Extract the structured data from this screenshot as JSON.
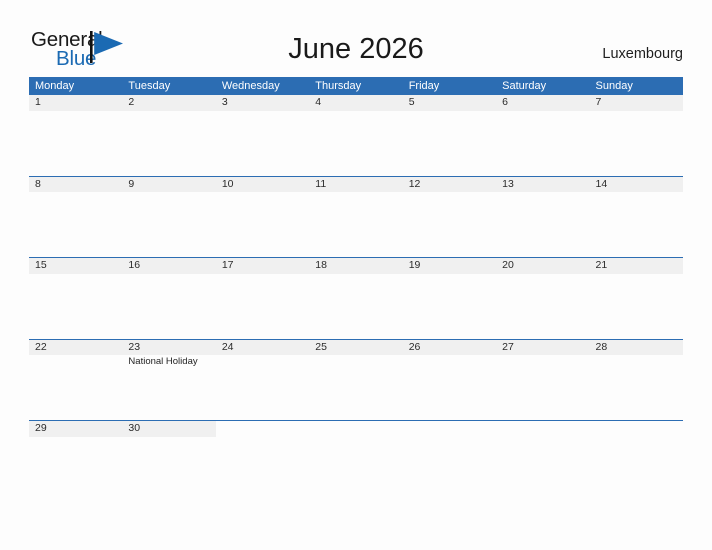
{
  "brand": {
    "name_top": "General",
    "name_bottom": "Blue",
    "flag_icon": "triangle-flag-icon",
    "color_primary": "#2c6db3",
    "color_logo_blue": "#1b6ab3"
  },
  "header": {
    "title": "June 2026",
    "region": "Luxembourg"
  },
  "calendar": {
    "weekdays": [
      "Monday",
      "Tuesday",
      "Wednesday",
      "Thursday",
      "Friday",
      "Saturday",
      "Sunday"
    ],
    "weeks": [
      {
        "tall": true,
        "days": [
          {
            "num": "1",
            "events": []
          },
          {
            "num": "2",
            "events": []
          },
          {
            "num": "3",
            "events": []
          },
          {
            "num": "4",
            "events": []
          },
          {
            "num": "5",
            "events": []
          },
          {
            "num": "6",
            "events": []
          },
          {
            "num": "7",
            "events": []
          }
        ]
      },
      {
        "tall": true,
        "days": [
          {
            "num": "8",
            "events": []
          },
          {
            "num": "9",
            "events": []
          },
          {
            "num": "10",
            "events": []
          },
          {
            "num": "11",
            "events": []
          },
          {
            "num": "12",
            "events": []
          },
          {
            "num": "13",
            "events": []
          },
          {
            "num": "14",
            "events": []
          }
        ]
      },
      {
        "tall": true,
        "days": [
          {
            "num": "15",
            "events": []
          },
          {
            "num": "16",
            "events": []
          },
          {
            "num": "17",
            "events": []
          },
          {
            "num": "18",
            "events": []
          },
          {
            "num": "19",
            "events": []
          },
          {
            "num": "20",
            "events": []
          },
          {
            "num": "21",
            "events": []
          }
        ]
      },
      {
        "tall": true,
        "days": [
          {
            "num": "22",
            "events": []
          },
          {
            "num": "23",
            "events": [
              "National Holiday"
            ]
          },
          {
            "num": "24",
            "events": []
          },
          {
            "num": "25",
            "events": []
          },
          {
            "num": "26",
            "events": []
          },
          {
            "num": "27",
            "events": []
          },
          {
            "num": "28",
            "events": []
          }
        ]
      },
      {
        "tall": false,
        "days": [
          {
            "num": "29",
            "events": []
          },
          {
            "num": "30",
            "events": []
          },
          {
            "num": "",
            "events": []
          },
          {
            "num": "",
            "events": []
          },
          {
            "num": "",
            "events": []
          },
          {
            "num": "",
            "events": []
          },
          {
            "num": "",
            "events": []
          }
        ]
      }
    ]
  }
}
